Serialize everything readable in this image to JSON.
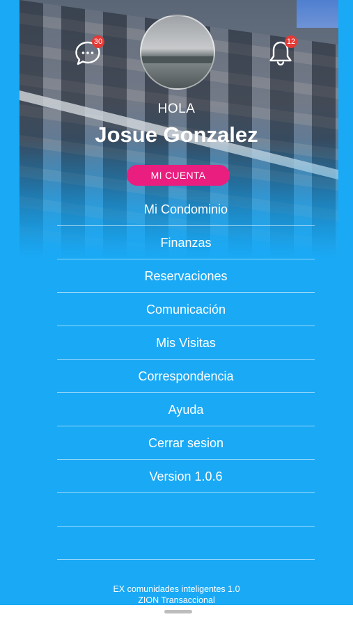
{
  "header": {
    "chat_badge": "30",
    "notification_badge": "12",
    "greeting": "HOLA",
    "user_name": "Josue Gonzalez",
    "account_button": "MI CUENTA"
  },
  "menu": {
    "items": [
      {
        "label": "Mi Condominio"
      },
      {
        "label": "Finanzas"
      },
      {
        "label": "Reservaciones"
      },
      {
        "label": "Comunicación"
      },
      {
        "label": "Mis Visitas"
      },
      {
        "label": "Correspondencia"
      },
      {
        "label": "Ayuda"
      },
      {
        "label": "Cerrar sesion"
      },
      {
        "label": "Version 1.0.6"
      },
      {
        "label": ""
      },
      {
        "label": ""
      }
    ]
  },
  "footer": {
    "line1": "EX comunidades inteligentes 1.0",
    "line2": "ZION Transaccional"
  },
  "colors": {
    "background": "#1aa9f5",
    "accent": "#e91e7f",
    "badge": "#e53935"
  },
  "icons": {
    "chat": "chat-bubble-icon",
    "notifications": "bell-icon"
  }
}
